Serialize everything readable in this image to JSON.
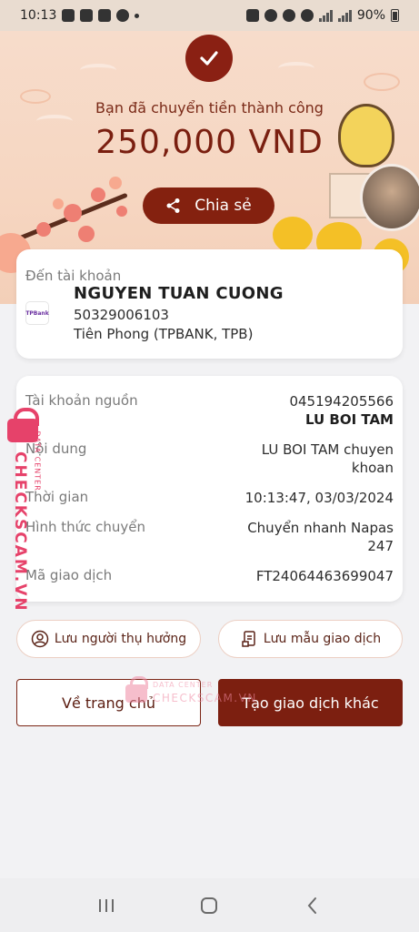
{
  "status_bar": {
    "time": "10:13",
    "battery": "90%"
  },
  "hero": {
    "subtitle": "Bạn đã chuyển tiền thành công",
    "amount": "250,000 VND",
    "share_label": "Chia sẻ"
  },
  "destination": {
    "label": "Đến tài khoản",
    "bank_logo_text": "TPBank",
    "name": "NGUYEN TUAN CUONG",
    "account_number": "50329006103",
    "bank": "Tiên Phong (TPBANK, TPB)"
  },
  "details": {
    "source_label": "Tài khoản nguồn",
    "source_account": "045194205566",
    "source_name": "LU BOI TAM",
    "content_label": "Nội dung",
    "content_line1": "LU BOI TAM chuyen",
    "content_line2": "khoan",
    "time_label": "Thời gian",
    "time_value": "10:13:47, 03/03/2024",
    "method_label": "Hình thức chuyển",
    "method_line1": "Chuyển nhanh Napas",
    "method_line2": "247",
    "txn_label": "Mã giao dịch",
    "txn_value": "FT24064463699047"
  },
  "watermark": {
    "side_small": "DATA CENTER",
    "side_big": "CHECKSCAM.VN",
    "center_small": "DATA CENTER",
    "center_big": "CHECKSCAM.VN"
  },
  "actions": {
    "save_recipient": "Lưu người thụ hưởng",
    "save_template": "Lưu mẫu giao dịch",
    "home": "Về trang chủ",
    "new_transaction": "Tạo giao dịch khác"
  },
  "colors": {
    "brand": "#7c1f10",
    "watermark": "#e6426a",
    "hero_bg": "#f6d6c1"
  }
}
